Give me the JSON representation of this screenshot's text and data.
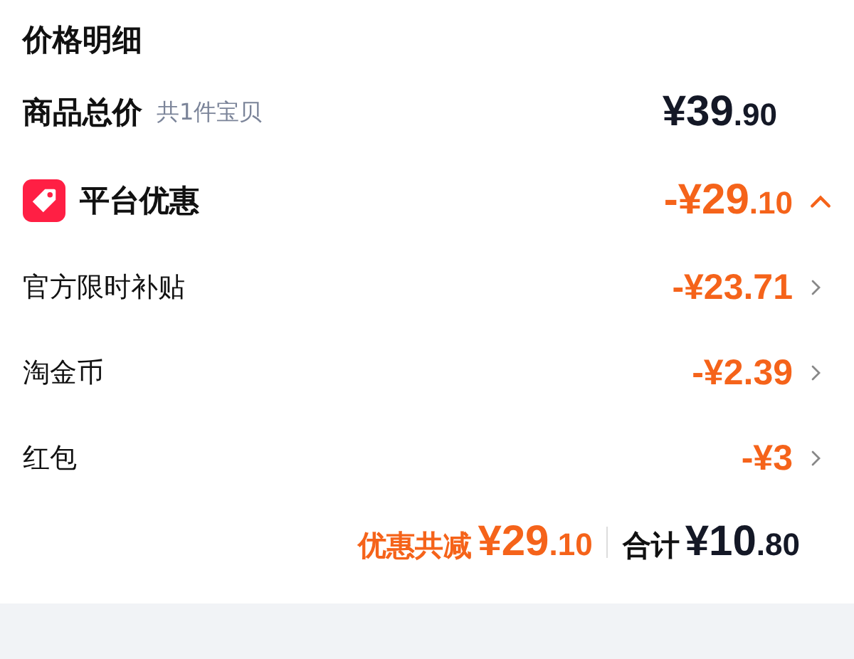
{
  "title": "价格明细",
  "total_row": {
    "label": "商品总价",
    "note": "共1件宝贝",
    "price": {
      "main": "¥39",
      "cents": ".90"
    }
  },
  "discount": {
    "label": "平台优惠",
    "price": {
      "main": "-¥29",
      "cents": ".10"
    },
    "expanded": true,
    "children": [
      {
        "label": "官方限时补贴",
        "amount": "-¥23.71"
      },
      {
        "label": "淘金币",
        "amount": "-¥2.39"
      },
      {
        "label": "红包",
        "amount": "-¥3"
      }
    ]
  },
  "summary": {
    "saved_label": "优惠共减",
    "saved_price": {
      "main": "¥29",
      "cents": ".10"
    },
    "total_label": "合计",
    "total_price": {
      "main": "¥10",
      "cents": ".80"
    }
  }
}
